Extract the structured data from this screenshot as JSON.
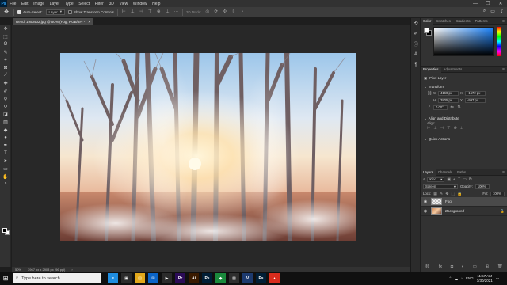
{
  "menubar": {
    "logo": "Ps",
    "items": [
      "File",
      "Edit",
      "Image",
      "Layer",
      "Type",
      "Select",
      "Filter",
      "3D",
      "View",
      "Window",
      "Help"
    ],
    "window_controls": [
      "—",
      "❐",
      "✕"
    ]
  },
  "options": {
    "auto_select_label": "Auto-Select:",
    "auto_select_target": "Layer",
    "transform_label": "Show Transform Controls",
    "mode_label": "3D Mode:"
  },
  "document": {
    "tab_title": "Rendi 1950402.jpg @ 50% (Fog, RGB/8#) *",
    "tab_close": "×",
    "zoom": "50%",
    "size_info": "3967 px x 2908 px (96 ppi)"
  },
  "color_panel": {
    "tabs": [
      "Color",
      "Swatches",
      "Gradients",
      "Patterns"
    ]
  },
  "properties": {
    "tabs": [
      "Properties",
      "Adjustments"
    ],
    "layer_type": "Pixel Layer",
    "transform_title": "Transform",
    "w_label": "W",
    "w_value": "4160 px",
    "x_label": "X",
    "x_value": "-1572 px",
    "h_label": "H",
    "h_value": "3805 px",
    "y_label": "Y",
    "y_value": "-997 px",
    "angle_value": "0.00°",
    "align_title": "Align and Distribute",
    "align_label": "Align:",
    "quick_actions_title": "Quick Actions"
  },
  "layers": {
    "tabs": [
      "Layers",
      "Channels",
      "Paths"
    ],
    "filter_kind": "Kind",
    "blend_mode": "Screen",
    "opacity_label": "Opacity:",
    "opacity_value": "100%",
    "lock_label": "Lock:",
    "fill_label": "Fill:",
    "fill_value": "100%",
    "items": [
      {
        "name": "Fog",
        "selected": true
      },
      {
        "name": "Background",
        "selected": false
      }
    ]
  },
  "taskbar": {
    "search_placeholder": "Type here to search",
    "apps": [
      {
        "label": "e",
        "color": "#1f8ddf"
      },
      {
        "label": "▣",
        "color": "#2b2b2b"
      },
      {
        "label": "▤",
        "color": "#e2a81b"
      },
      {
        "label": "✉",
        "color": "#0a64c8"
      },
      {
        "label": "▶",
        "color": "#2b2b2b"
      },
      {
        "label": "Pr",
        "color": "#2b0b57"
      },
      {
        "label": "Ai",
        "color": "#3a1a00"
      },
      {
        "label": "Ps",
        "color": "#001e36"
      },
      {
        "label": "◆",
        "color": "#1a8a3c"
      },
      {
        "label": "▦",
        "color": "#2e2e2e"
      },
      {
        "label": "V",
        "color": "#1d3a6e"
      },
      {
        "label": "Ps",
        "color": "#001e36"
      },
      {
        "label": "▲",
        "color": "#d92c1d"
      }
    ],
    "tray": {
      "lang": "ENG",
      "time": "11:57 AM",
      "date": "1/30/2021"
    }
  }
}
